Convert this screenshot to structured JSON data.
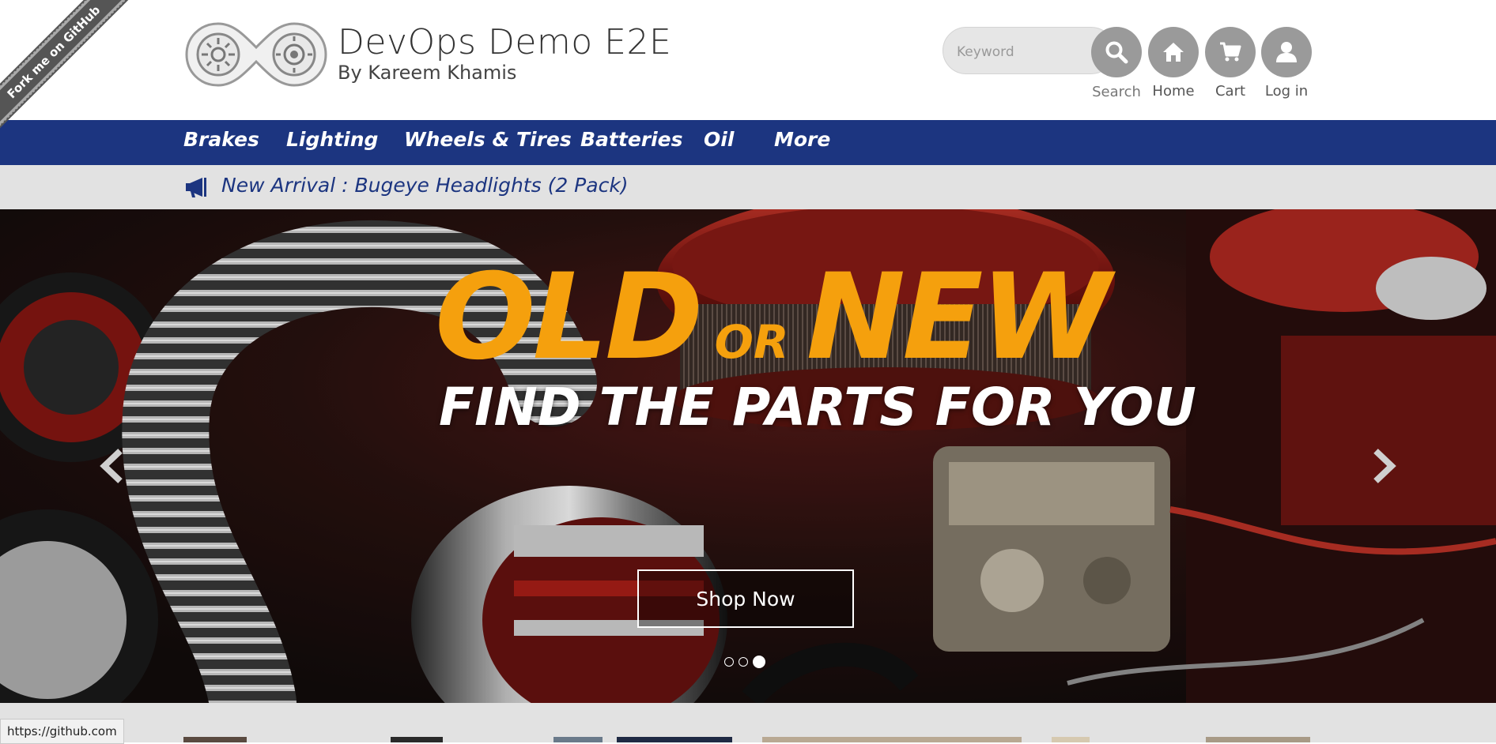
{
  "ribbon": {
    "label": "Fork me on GitHub"
  },
  "brand": {
    "title": "DevOps Demo E2E",
    "subtitle": "By Kareem Khamis"
  },
  "search": {
    "placeholder": "Keyword",
    "label": "Search"
  },
  "header_buttons": {
    "home": "Home",
    "cart": "Cart",
    "login": "Log in"
  },
  "nav": {
    "items": [
      "Brakes",
      "Lighting",
      "Wheels & Tires",
      "Batteries",
      "Oil",
      "More"
    ]
  },
  "announcement": {
    "text": "New Arrival : Bugeye Headlights (2 Pack)"
  },
  "hero": {
    "headline_old": "OLD",
    "headline_or": "OR",
    "headline_new": "NEW",
    "subline": "FIND THE PARTS FOR YOU",
    "button": "Shop Now",
    "slide_count": 3,
    "active_slide": 3
  },
  "status_bar": {
    "url": "https://github.com"
  },
  "colors": {
    "nav_bg": "#1c3580",
    "accent_orange": "#f5a00d",
    "icon_gray": "#9a9a9a"
  }
}
